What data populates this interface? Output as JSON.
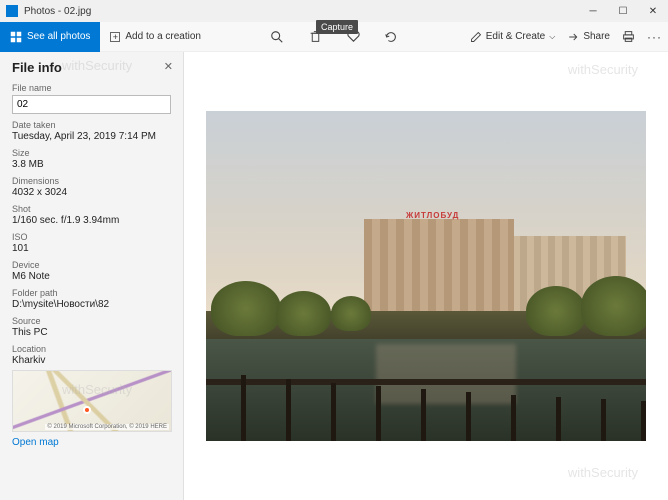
{
  "window": {
    "title": "Photos - 02.jpg"
  },
  "toolbar": {
    "see_all": "See all photos",
    "add_creation": "Add to a creation",
    "tooltip_capture": "Capture",
    "edit_create": "Edit & Create",
    "share": "Share"
  },
  "panel": {
    "title": "File info",
    "filename_label": "File name",
    "filename_value": "02",
    "fields": [
      {
        "label": "Date taken",
        "value": "Tuesday, April 23, 2019 7:14 PM"
      },
      {
        "label": "Size",
        "value": "3.8 MB"
      },
      {
        "label": "Dimensions",
        "value": "4032 x 3024"
      },
      {
        "label": "Shot",
        "value": "1/160 sec. f/1.9 3.94mm"
      },
      {
        "label": "ISO",
        "value": "101"
      },
      {
        "label": "Device",
        "value": "M6 Note"
      },
      {
        "label": "Folder path",
        "value": "D:\\mysite\\Новости\\82"
      },
      {
        "label": "Source",
        "value": "This PC"
      },
      {
        "label": "Location",
        "value": "Kharkiv"
      }
    ],
    "map_copyright": "© 2019 Microsoft Corporation, © 2019 HERE",
    "open_map": "Open map"
  },
  "photo": {
    "sign_text": "ЖИТЛОБУД"
  },
  "watermark": "withSecurity"
}
